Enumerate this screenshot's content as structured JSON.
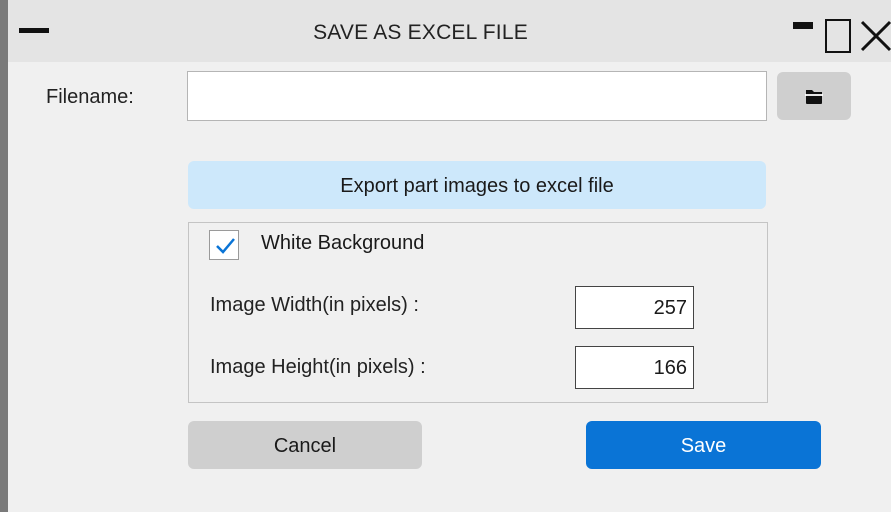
{
  "window": {
    "title": "SAVE AS EXCEL FILE"
  },
  "filename": {
    "label": "Filename:",
    "value": "",
    "placeholder": ""
  },
  "export": {
    "header": "Export part images to excel file",
    "white_background": {
      "label": "White Background",
      "checked": true
    },
    "image_width": {
      "label": "Image Width(in pixels) :",
      "value": "257"
    },
    "image_height": {
      "label": "Image Height(in pixels) :",
      "value": "166"
    }
  },
  "buttons": {
    "cancel": "Cancel",
    "save": "Save"
  },
  "icons": {
    "system_menu": "menu-dash-icon",
    "minimize": "minimize-icon",
    "maximize": "maximize-icon",
    "close": "close-icon",
    "browse": "folder-icon",
    "checkbox": "checkmark-icon"
  },
  "colors": {
    "accent": "#0a74d6",
    "header_bg": "#cde8fb",
    "button_gray": "#cfcfcf"
  }
}
